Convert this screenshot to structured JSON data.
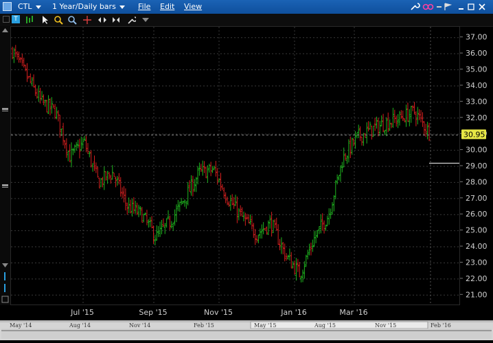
{
  "window": {
    "symbol": "CTL",
    "period": "1 Year/Daily bars",
    "menus": [
      "File",
      "Edit",
      "View"
    ]
  },
  "toolbar": {
    "icons": [
      "text-tool-icon",
      "bar-type-icon",
      "cursor-icon",
      "zoom-in-icon",
      "zoom-out-icon",
      "crosshair-icon",
      "fit-horizontal-icon",
      "compress-icon",
      "settings-icon",
      "triangle-down-icon"
    ]
  },
  "chart_data": {
    "type": "candlestick",
    "ylim": [
      20.5,
      37.5
    ],
    "y_ticks": [
      "37.00",
      "36.00",
      "35.00",
      "34.00",
      "33.00",
      "32.00",
      "31.00",
      "30.00",
      "29.00",
      "28.00",
      "27.00",
      "26.00",
      "25.00",
      "24.00",
      "23.00",
      "22.00",
      "21.00"
    ],
    "x_ticks": [
      "Jul '15",
      "Sep '15",
      "Nov '15",
      "Jan '16",
      "Mar '16"
    ],
    "last_price": "30.95",
    "price_path": [
      {
        "x": "May '15",
        "y": 36.2
      },
      {
        "x": "late May '15",
        "y": 34.6
      },
      {
        "x": "early Jun '15",
        "y": 33.0
      },
      {
        "x": "mid Jun '15",
        "y": 32.4
      },
      {
        "x": "late Jun '15",
        "y": 29.6
      },
      {
        "x": "early Jul '15",
        "y": 30.5
      },
      {
        "x": "mid Jul '15",
        "y": 28.0
      },
      {
        "x": "late Jul '15",
        "y": 28.6
      },
      {
        "x": "Aug '15",
        "y": 26.5
      },
      {
        "x": "mid Aug '15",
        "y": 26.0
      },
      {
        "x": "Sep '15",
        "y": 24.6
      },
      {
        "x": "late Sep '15",
        "y": 25.6
      },
      {
        "x": "Oct '15",
        "y": 27.0
      },
      {
        "x": "mid Oct '15",
        "y": 28.6
      },
      {
        "x": "Nov '15",
        "y": 28.8
      },
      {
        "x": "mid Nov '15",
        "y": 27.0
      },
      {
        "x": "Dec '15",
        "y": 25.8
      },
      {
        "x": "mid Dec '15",
        "y": 24.8
      },
      {
        "x": "late Dec '15",
        "y": 25.5
      },
      {
        "x": "Jan '16",
        "y": 23.5
      },
      {
        "x": "mid Jan '16",
        "y": 22.3
      },
      {
        "x": "late Jan '16",
        "y": 24.5
      },
      {
        "x": "early Feb '16",
        "y": 26.0
      },
      {
        "x": "Feb '16",
        "y": 29.5
      },
      {
        "x": "mid Feb '16",
        "y": 30.8
      },
      {
        "x": "Mar '16",
        "y": 31.3
      },
      {
        "x": "mid Mar '16",
        "y": 31.7
      },
      {
        "x": "Apr '16",
        "y": 32.0
      },
      {
        "x": "mid Apr '16",
        "y": 32.4
      },
      {
        "x": "late Apr '16",
        "y": 31.1
      }
    ]
  },
  "navigator": {
    "labels": [
      "May '14",
      "Aug '14",
      "Nov '14",
      "Feb '15",
      "May '15",
      "Aug '15",
      "Nov '15",
      "Feb '16"
    ]
  },
  "colors": {
    "up": "#1fb51f",
    "down": "#d41f1f",
    "grid": "#3a3a3a",
    "axis_text": "#d0d0d0",
    "price_badge": "#e6e645"
  }
}
